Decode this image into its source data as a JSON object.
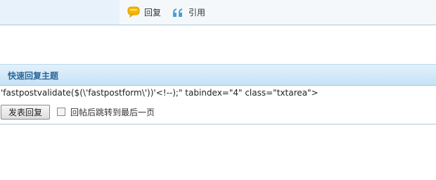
{
  "actions": {
    "reply_label": "回复",
    "quote_label": "引用",
    "reply_icon": "reply-bubble-icon",
    "quote_icon": "quote-icon"
  },
  "quick_reply": {
    "title": "快速回复主题",
    "stray_markup": "'fastpostvalidate($(\\'fastpostform\\'))'<!--);\" tabindex=\"4\" class=\"txtarea\">",
    "submit_label": "发表回复",
    "jump_label": "回帖后跳转到最后一页",
    "jump_checked": false
  },
  "colors": {
    "accent": "#2b6699",
    "border": "#a9cbe0",
    "header_bg": "#c5e2f5",
    "quote_icon": "#4aa0d8",
    "reply_icon": "#f5b800"
  }
}
